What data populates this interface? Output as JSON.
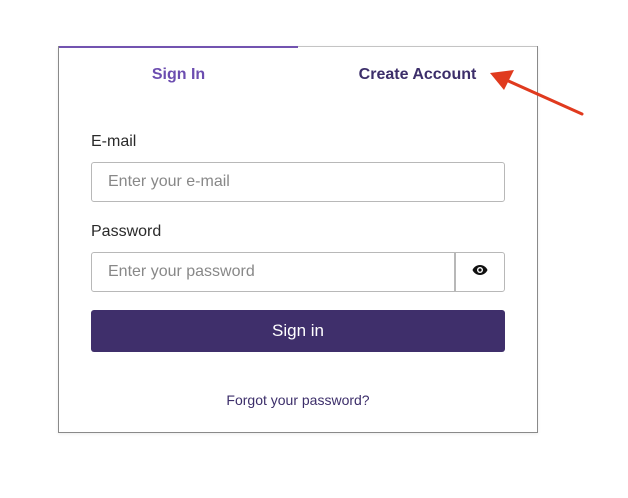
{
  "tabs": {
    "sign_in": "Sign In",
    "create_account": "Create Account"
  },
  "form": {
    "email_label": "E-mail",
    "email_placeholder": "Enter your e-mail",
    "email_value": "",
    "password_label": "Password",
    "password_placeholder": "Enter your password",
    "password_value": "",
    "show_password_icon": "eye-icon",
    "submit_label": "Sign in",
    "forgot_link": "Forgot your password?"
  },
  "annotation": {
    "arrow_color": "#e03a1e",
    "arrow_target": "create-account-tab"
  },
  "colors": {
    "accent": "#6c4db0",
    "button": "#3f2f6b",
    "link": "#3c2e6a"
  }
}
